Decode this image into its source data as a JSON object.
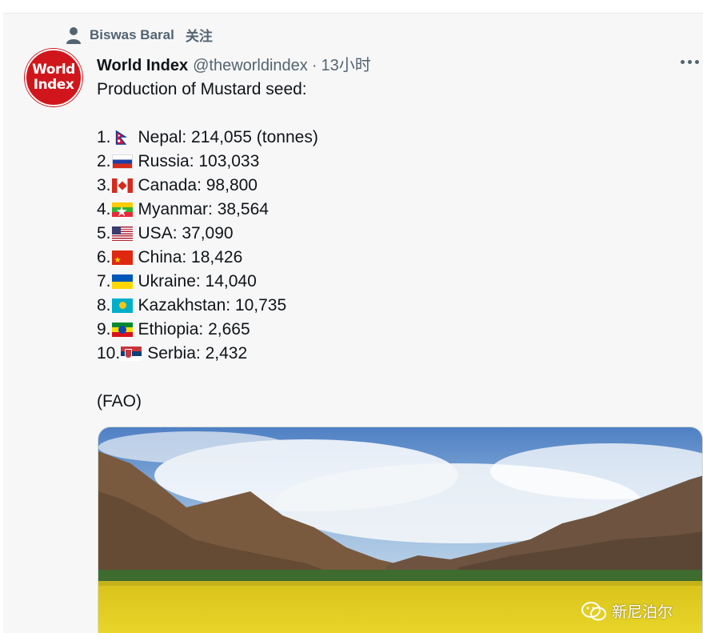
{
  "retweet": {
    "retweeter": "Biswas Baral",
    "follow_label": "关注"
  },
  "tweet": {
    "author_name": "World Index",
    "handle": "@theworldindex",
    "separator": "·",
    "time": "13小时",
    "avatar_text_line1": "World",
    "avatar_text_line2": "Index",
    "intro": "Production of Mustard seed:",
    "ranking": [
      {
        "rank": "1.",
        "flag": "nepal-flag",
        "text": "Nepal: 214,055 (tonnes)"
      },
      {
        "rank": "2.",
        "flag": "russia-flag",
        "text": "Russia: 103,033"
      },
      {
        "rank": "3.",
        "flag": "canada-flag",
        "text": "Canada: 98,800"
      },
      {
        "rank": "4.",
        "flag": "myanmar-flag",
        "text": "Myanmar: 38,564"
      },
      {
        "rank": "5.",
        "flag": "usa-flag",
        "text": "USA: 37,090"
      },
      {
        "rank": "6.",
        "flag": "china-flag",
        "text": "China: 18,426"
      },
      {
        "rank": "7.",
        "flag": "ukraine-flag",
        "text": "Ukraine: 14,040"
      },
      {
        "rank": "8.",
        "flag": "kazakhstan-flag",
        "text": "Kazakhstan: 10,735"
      },
      {
        "rank": "9.",
        "flag": "ethiopia-flag",
        "text": "Ethiopia: 2,665"
      },
      {
        "rank": "10.",
        "flag": "serbia-flag",
        "text": "Serbia: 2,432"
      }
    ],
    "source": "(FAO)"
  },
  "watermark": {
    "icon": "wechat-icon",
    "text": "新尼泊尔"
  },
  "colors": {
    "muted_text": "#536471",
    "avatar_red": "#d0161c",
    "mustard_yellow": "#e6d21a"
  }
}
